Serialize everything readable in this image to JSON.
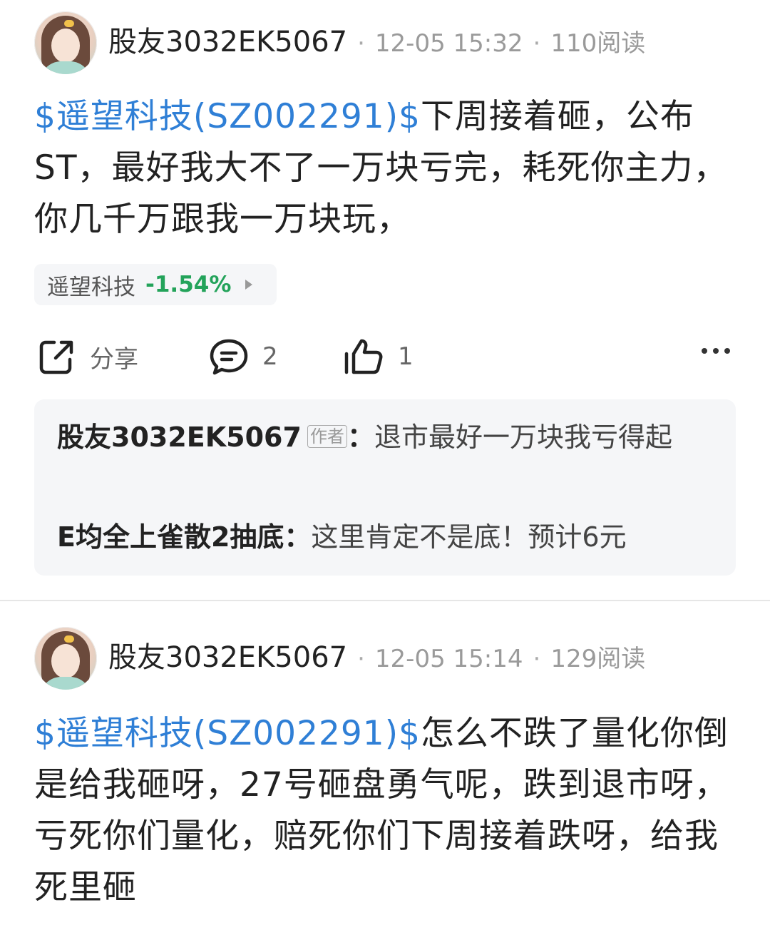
{
  "posts": [
    {
      "username": "股友3032EK5067",
      "time": "12-05 15:32",
      "reads": "110阅读",
      "stock_link": "$遥望科技(SZ002291)$",
      "body": "下周接着砸，公布ST，最好我大不了一万块亏完，耗死你主力，你几千万跟我一万块玩，",
      "stock_chip": {
        "name": "遥望科技",
        "change": "-1.54%",
        "change_color": "#23a35a"
      },
      "actions": {
        "share_label": "分享",
        "comment_count": "2",
        "like_count": "1"
      },
      "comments": [
        {
          "name": "股友3032EK5067",
          "tag": "作者",
          "colon": "：",
          "text": "退市最好一万块我亏得起"
        },
        {
          "name": "E均全上雀散2抽底",
          "colon": "：",
          "text": "这里肯定不是底！预计6元"
        }
      ]
    },
    {
      "username": "股友3032EK5067",
      "time": "12-05 15:14",
      "reads": "129阅读",
      "stock_link": "$遥望科技(SZ002291)$",
      "body": "怎么不跌了量化你倒是给我砸呀，27号砸盘勇气呢，跌到退市呀，亏死你们量化，赔死你们下周接着跌呀，给我死里砸"
    }
  ],
  "colors": {
    "link": "#2f7fd6",
    "down": "#23a35a",
    "meta": "#9a9a9a"
  },
  "icons": [
    "share-icon",
    "comment-icon",
    "like-icon",
    "more-icon"
  ]
}
